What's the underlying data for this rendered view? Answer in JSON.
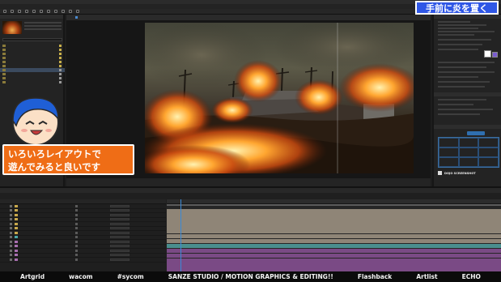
{
  "window": {
    "title": ""
  },
  "menu": [
    "",
    "",
    "",
    "",
    "",
    "",
    "",
    "",
    ""
  ],
  "project": {
    "tab": "",
    "search_placeholder": "",
    "items": [
      {
        "name": "",
        "color": "#c9b04a"
      },
      {
        "name": "",
        "color": "#c9b04a"
      },
      {
        "name": "",
        "color": "#c9b04a"
      },
      {
        "name": "",
        "color": "#c9b04a"
      },
      {
        "name": "",
        "color": "#c9b04a"
      },
      {
        "name": "",
        "color": "#c9b04a"
      },
      {
        "name": "",
        "color": "#9a9a9a"
      },
      {
        "name": "",
        "color": "#9a9a9a"
      },
      {
        "name": "",
        "color": "#9a9a9a"
      },
      {
        "name": "",
        "color": "#9a9a9a"
      }
    ],
    "selected_index": 6
  },
  "viewer": {
    "tab_1": "",
    "tab_2": "",
    "comp_name": "",
    "zoom": "",
    "quality": "",
    "footer_time": ""
  },
  "panels": {
    "properties": "",
    "effects": "",
    "align": "",
    "align_button": "",
    "plugin_name": "DOJO SCREENSHOT",
    "accent_color": "#2f6fb0"
  },
  "timeline": {
    "tab_1": "",
    "tab_2": "",
    "timecode": "",
    "ruler_ticks": [
      "",
      "",
      "",
      "",
      "",
      "",
      "",
      "",
      "",
      "",
      "",
      "",
      "",
      "",
      "",
      ""
    ],
    "layers": [
      {
        "num": "",
        "name": "",
        "label_color": "#c8a84c",
        "bar_color": "#8f8577"
      },
      {
        "num": "",
        "name": "",
        "label_color": "#c8a84c",
        "bar_color": "#8f8577"
      },
      {
        "num": "",
        "name": "",
        "label_color": "#c8a84c",
        "bar_color": "#8f8577"
      },
      {
        "num": "",
        "name": "",
        "label_color": "#c8a84c",
        "bar_color": "#8f8577"
      },
      {
        "num": "",
        "name": "",
        "label_color": "#c8a84c",
        "bar_color": "#8f8577"
      },
      {
        "num": "",
        "name": "",
        "label_color": "#c8a84c",
        "bar_color": "#8f8577"
      },
      {
        "num": "",
        "name": "",
        "label_color": "#c8a84c",
        "bar_color": "#8f8577"
      },
      {
        "num": "",
        "name": "",
        "label_color": "#4aa8a8",
        "bar_color": "#4a8e8e"
      },
      {
        "num": "",
        "name": "",
        "label_color": "#a86fb0",
        "bar_color": "#7a4a85"
      },
      {
        "num": "",
        "name": "",
        "label_color": "#a86fb0",
        "bar_color": "#7a4a85"
      },
      {
        "num": "",
        "name": "",
        "label_color": "#a86fb0",
        "bar_color": "#7a4a85"
      },
      {
        "num": "",
        "name": "",
        "label_color": "#a86fb0",
        "bar_color": "#7a4a85"
      },
      {
        "num": "",
        "name": "",
        "label_color": "#a86fb0",
        "bar_color": "#7a4a85"
      }
    ]
  },
  "overlay": {
    "title_badge": "手前に炎を置く",
    "caption_line1": "いろいろレイアウトで",
    "caption_line2": "遊んでみると良いです",
    "badge_color": "#2f57e6",
    "caption_color": "#ef6d16"
  },
  "sponsors": [
    "Artgrid",
    "wacom",
    "#sycom",
    "SANZE STUDIO  / MOTION GRAPHICS & EDITING!!",
    "Flashback",
    "Artlist",
    "ECHO"
  ]
}
